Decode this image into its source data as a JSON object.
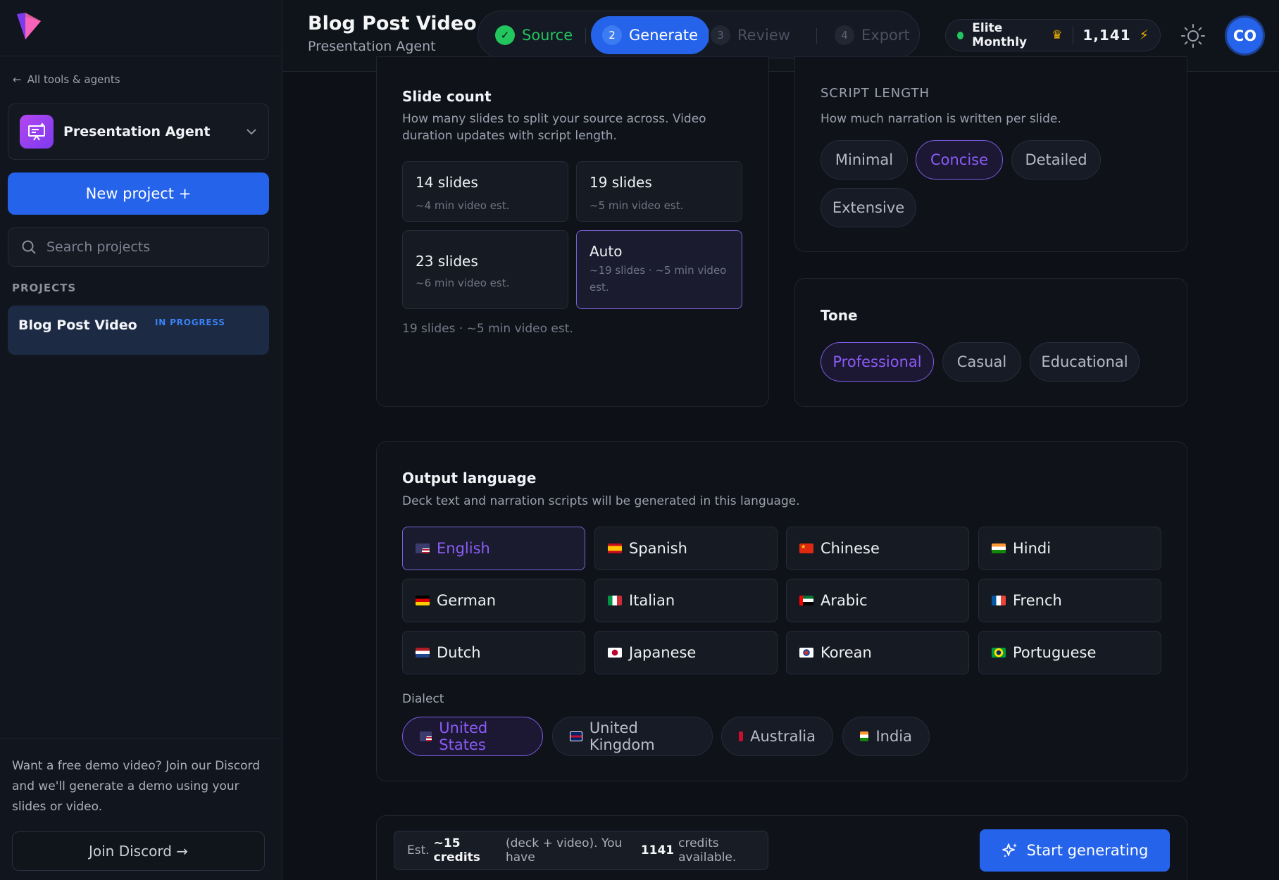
{
  "sidebar": {
    "back_link": "All tools & agents",
    "agent_name": "Presentation Agent",
    "new_project_label": "New project +",
    "search_placeholder": "Search projects",
    "projects_label": "PROJECTS",
    "projects": [
      {
        "name": "Blog Post Video",
        "status": "IN PROGRESS"
      }
    ],
    "footer_text": "Want a free demo video? Join our Discord and we'll generate a demo using your slides or video.",
    "discord_label": "Join Discord →"
  },
  "header": {
    "title": "Blog Post Video",
    "subtitle": "Presentation Agent",
    "steps": [
      {
        "num": "✓",
        "label": "Source",
        "state": "done"
      },
      {
        "num": "2",
        "label": "Generate",
        "state": "active"
      },
      {
        "num": "3",
        "label": "Review",
        "state": "pending"
      },
      {
        "num": "4",
        "label": "Export",
        "state": "pending"
      }
    ],
    "plan_name": "Elite Monthly",
    "credits": "1,141",
    "avatar_initials": "CO"
  },
  "slide_count": {
    "title": "Slide count",
    "desc": "How many slides to split your source across. Video duration updates with script length.",
    "options": [
      {
        "title": "14 slides",
        "sub": "~4 min video est."
      },
      {
        "title": "19 slides",
        "sub": "~5 min video est."
      },
      {
        "title": "23 slides",
        "sub": "~6 min video est."
      },
      {
        "title": "Auto",
        "sub": "~19 slides · ~5 min video est."
      }
    ],
    "selected": "Auto",
    "summary": "19 slides · ~5 min video est."
  },
  "script_length": {
    "title": "SCRIPT LENGTH",
    "desc": "How much narration is written per slide.",
    "options": [
      "Minimal",
      "Concise",
      "Detailed",
      "Extensive"
    ],
    "selected": "Concise"
  },
  "tone": {
    "title": "Tone",
    "options": [
      "Professional",
      "Casual",
      "Educational"
    ],
    "selected": "Professional"
  },
  "output_language": {
    "title": "Output language",
    "desc": "Deck text and narration scripts will be generated in this language.",
    "languages": [
      "English",
      "Spanish",
      "Chinese",
      "Hindi",
      "German",
      "Italian",
      "Arabic",
      "French",
      "Dutch",
      "Japanese",
      "Korean",
      "Portuguese"
    ],
    "selected": "English",
    "dialect_label": "Dialect",
    "dialects": [
      "United States",
      "United Kingdom",
      "Australia",
      "India"
    ],
    "selected_dialect": "United States"
  },
  "footer": {
    "est_prefix": "Est.",
    "est_credits": "~15 credits",
    "est_mid": "(deck + video). You have",
    "available": "1141",
    "est_suffix": "credits available.",
    "start_label": "Start generating"
  },
  "colors": {
    "accent": "#2563eb",
    "selected": "#8b5cf6",
    "success": "#22c55e"
  }
}
